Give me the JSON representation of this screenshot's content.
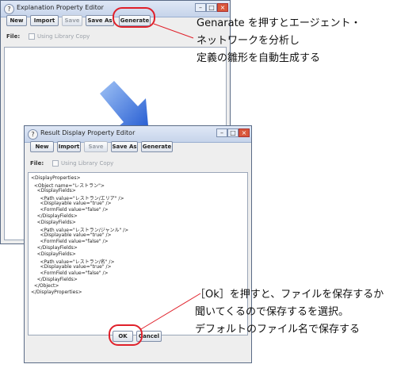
{
  "window1": {
    "title": "Explanation Property Editor",
    "buttons": {
      "new": "New",
      "import": "Import",
      "save": "Save",
      "save_as": "Save As",
      "generate": "Generate"
    },
    "file_label": "File:",
    "library_copy": "Using Library Copy"
  },
  "window2": {
    "title": "Result Display Property Editor",
    "buttons": {
      "new": "New",
      "import": "Import",
      "save": "Save",
      "save_as": "Save As",
      "generate": "Generate",
      "ok": "OK",
      "cancel": "Cancel"
    },
    "file_label": "File:",
    "library_copy": "Using Library Copy",
    "xml_lines": [
      "<DisplayProperties>",
      "  <Object name=\"レストラン\">",
      "    <DisplayFields>",
      "      <Path value=\"レストラン/エリア\" />",
      "      <Displayable value=\"true\" />",
      "      <FormField value=\"false\" />",
      "    </DisplayFields>",
      "    <DisplayFields>",
      "      <Path value=\"レストラン/ジャンル\" />",
      "      <Displayable value=\"true\" />",
      "      <FormField value=\"false\" />",
      "    </DisplayFields>",
      "    <DisplayFields>",
      "      <Path value=\"レストラン/名\" />",
      "      <Displayable value=\"true\" />",
      "      <FormField value=\"false\" />",
      "    </DisplayFields>",
      "  </Object>",
      "</DisplayProperties>"
    ]
  },
  "annotations": {
    "top": [
      "Genarate を押すとエージェント・",
      "ネットワークを分析し",
      "定義の雛形を自動生成する"
    ],
    "bottom": [
      "［Ok］を押すと、ファイルを保存するか",
      "聞いてくるので保存するを選択。",
      "デフォルトのファイル名で保存する"
    ]
  },
  "colors": {
    "highlight": "#e0202a",
    "arrow": "#2f66d8"
  }
}
